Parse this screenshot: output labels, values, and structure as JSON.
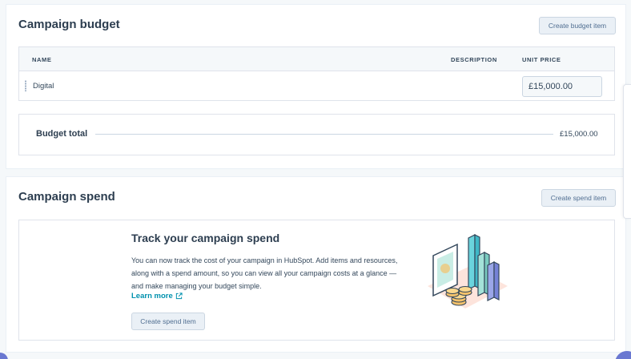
{
  "budget": {
    "title": "Campaign budget",
    "create_button": "Create budget item",
    "columns": {
      "name": "NAME",
      "description": "DESCRIPTION",
      "unit_price": "UNIT PRICE"
    },
    "rows": [
      {
        "name": "Digital",
        "description": "",
        "unit_price": "£15,000.00"
      }
    ],
    "total_label": "Budget total",
    "total_value": "£15,000.00"
  },
  "spend": {
    "title": "Campaign spend",
    "create_button": "Create spend item",
    "empty_state": {
      "title": "Track your campaign spend",
      "description": "You can now track the cost of your campaign in HubSpot. Add items and resources, along with a spend amount, so you can view all your campaign costs at a glance — and make managing your budget simple.",
      "learn_more": "Learn more",
      "button": "Create spend item",
      "illustration": "bar-chart-coins-illustration"
    }
  },
  "icons": {
    "drag": "drag-handle-icon",
    "external": "external-link-icon"
  },
  "colors": {
    "link": "#0091ae",
    "button_bg": "#eaf0f6",
    "text_primary": "#33475b"
  }
}
